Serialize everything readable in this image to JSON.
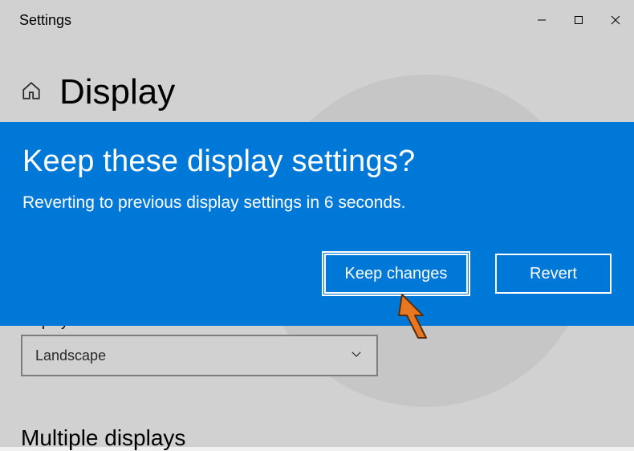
{
  "window": {
    "title": "Settings"
  },
  "page": {
    "title": "Display"
  },
  "orientation": {
    "label": "Display orientation",
    "value": "Landscape"
  },
  "multiple_displays": {
    "title": "Multiple displays"
  },
  "dialog": {
    "title": "Keep these display settings?",
    "message": "Reverting to previous display settings in  6 seconds.",
    "keep_label": "Keep changes",
    "revert_label": "Revert"
  }
}
